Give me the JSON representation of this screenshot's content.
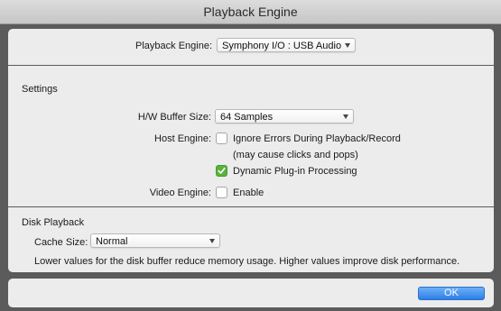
{
  "window": {
    "title": "Playback Engine"
  },
  "engine": {
    "label": "Playback Engine:",
    "value": "Symphony I/O : USB Audio"
  },
  "settings": {
    "title": "Settings",
    "buffer_label": "H/W Buffer Size:",
    "buffer_value": "64 Samples",
    "host_label": "Host Engine:",
    "ignore_errors_label": "Ignore Errors During Playback/Record",
    "ignore_errors_checked": false,
    "ignore_errors_note": "(may cause clicks and pops)",
    "dynamic_plugin_label": "Dynamic Plug-in Processing",
    "dynamic_plugin_checked": true,
    "video_label": "Video Engine:",
    "enable_label": "Enable",
    "enable_checked": false
  },
  "disk": {
    "title": "Disk Playback",
    "cache_label": "Cache Size:",
    "cache_value": "Normal",
    "note": "Lower values for the disk buffer reduce memory usage.  Higher values improve disk performance."
  },
  "footer": {
    "ok_label": "OK"
  },
  "colors": {
    "accent": "#2c7fe6",
    "check": "#58b33c"
  }
}
